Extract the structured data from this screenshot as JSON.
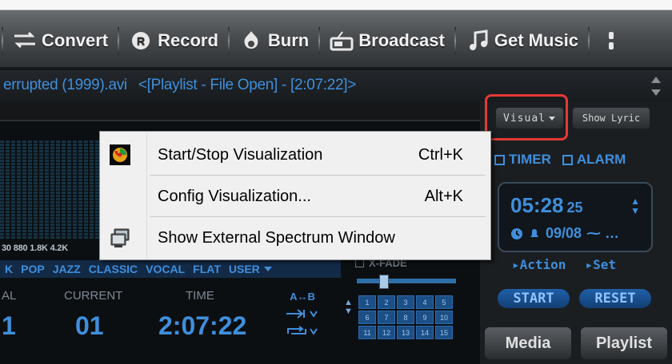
{
  "toolbar": {
    "items": [
      {
        "label": "Convert",
        "icon": "convert-icon"
      },
      {
        "label": "Record",
        "icon": "record-icon"
      },
      {
        "label": "Burn",
        "icon": "burn-icon"
      },
      {
        "label": "Broadcast",
        "icon": "broadcast-icon"
      },
      {
        "label": "Get Music",
        "icon": "music-note-icon"
      }
    ]
  },
  "title": {
    "file": "errupted (1999).avi",
    "playlist_info": "<[Playlist - File Open] - [2:07:22]>"
  },
  "right_panel": {
    "visual_label": "Visual",
    "lyric_label": "Show Lyric",
    "timer_label": "TIMER",
    "alarm_label": "ALARM",
    "clock_time": "05:28",
    "clock_seconds": "25",
    "clock_date": "09/08",
    "action_label": "Action",
    "set_label": "Set",
    "start_label": "START",
    "reset_label": "RESET",
    "media_label": "Media",
    "playlist_label": "Playlist"
  },
  "player": {
    "freq_labels": "30 880 1.8K 4.2K",
    "eq_presets": [
      "K",
      "POP",
      "JAZZ",
      "CLASSIC",
      "VOCAL",
      "FLAT",
      "USER"
    ],
    "label_total_fragment": "AL",
    "label_current": "CURRENT",
    "label_time": "TIME",
    "total_fragment": "1",
    "current_value": "01",
    "time_value": "2:07:22",
    "ab_label": "A↔B",
    "xfade_label": "X-FADE",
    "playlist_numbers": [
      "1",
      "2",
      "3",
      "4",
      "5",
      "6",
      "7",
      "8",
      "9",
      "10",
      "11",
      "12",
      "13",
      "14",
      "15"
    ]
  },
  "context_menu": {
    "items": [
      {
        "label": "Start/Stop Visualization",
        "shortcut": "Ctrl+K",
        "icon": "visualization-swirl-icon"
      },
      {
        "label": "Config Visualization...",
        "shortcut": "Alt+K",
        "icon": ""
      },
      {
        "label": "Show External Spectrum Window",
        "shortcut": "",
        "icon": "monitor-icon"
      }
    ]
  },
  "colors": {
    "accent": "#3f8fdc",
    "highlight": "#e53935"
  }
}
